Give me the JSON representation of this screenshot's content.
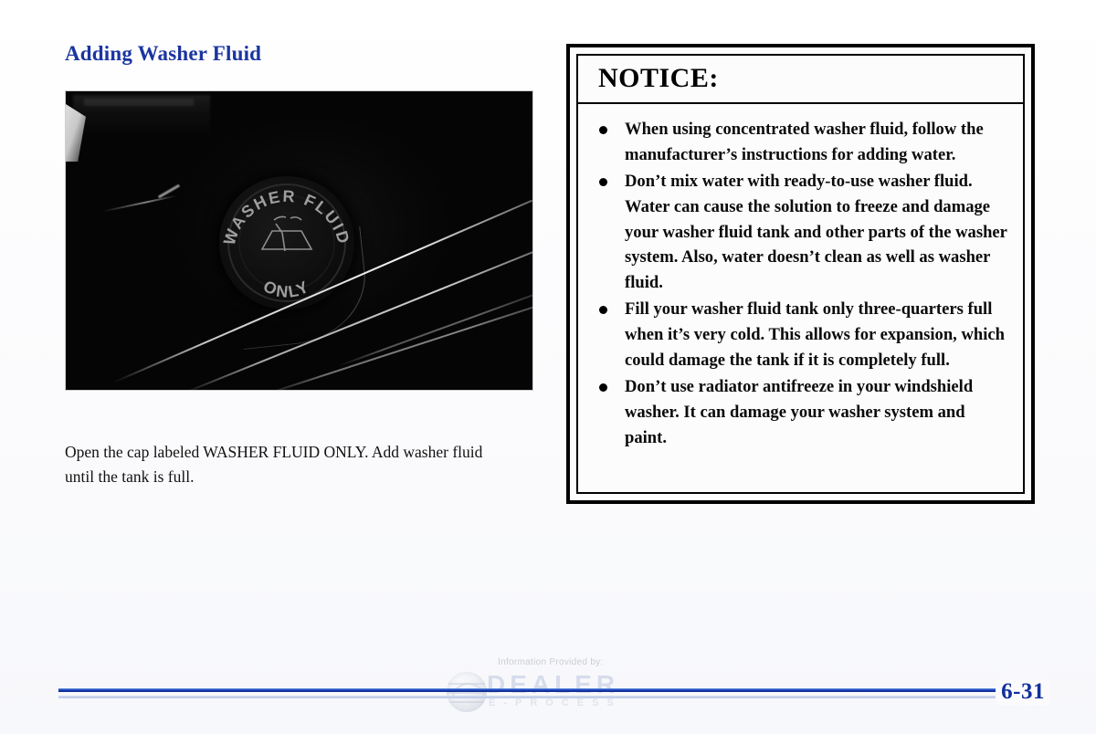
{
  "document": {
    "section_heading": "Adding Washer Fluid",
    "caption": "Open the cap labeled WASHER FLUID ONLY. Add washer fluid until the tank is full.",
    "page_number": "6-31"
  },
  "photo": {
    "alt": "Dark engine compartment photo showing the washer fluid reservoir cap",
    "cap_label_top": "WASHER FLUID",
    "cap_label_bottom": "ONLY"
  },
  "notice": {
    "title": "NOTICE:",
    "bullets": [
      "When using concentrated washer fluid, follow the manufacturer’s instructions for adding water.",
      "Don’t mix water with ready-to-use washer fluid. Water can cause the solution to freeze and damage your washer fluid tank and other parts of the washer system. Also, water doesn’t clean as well as washer fluid.",
      "Fill your washer fluid tank only three-quarters full when it’s very cold. This allows for expansion, which could damage the tank if it is completely full.",
      "Don’t use radiator antifreeze in your windshield washer. It can damage your washer system and paint."
    ]
  },
  "watermark": {
    "caption": "Information Provided by:",
    "brand": "DEALER",
    "sub_brand": "E-PROCESS"
  },
  "colors": {
    "heading_blue": "#1b35a0",
    "page_number_blue": "#10309c",
    "rule_blue": "#1a3fb5",
    "rule_light": "#b9c7e6",
    "notice_border": "#000000",
    "page_background": "#fbfbfd"
  }
}
